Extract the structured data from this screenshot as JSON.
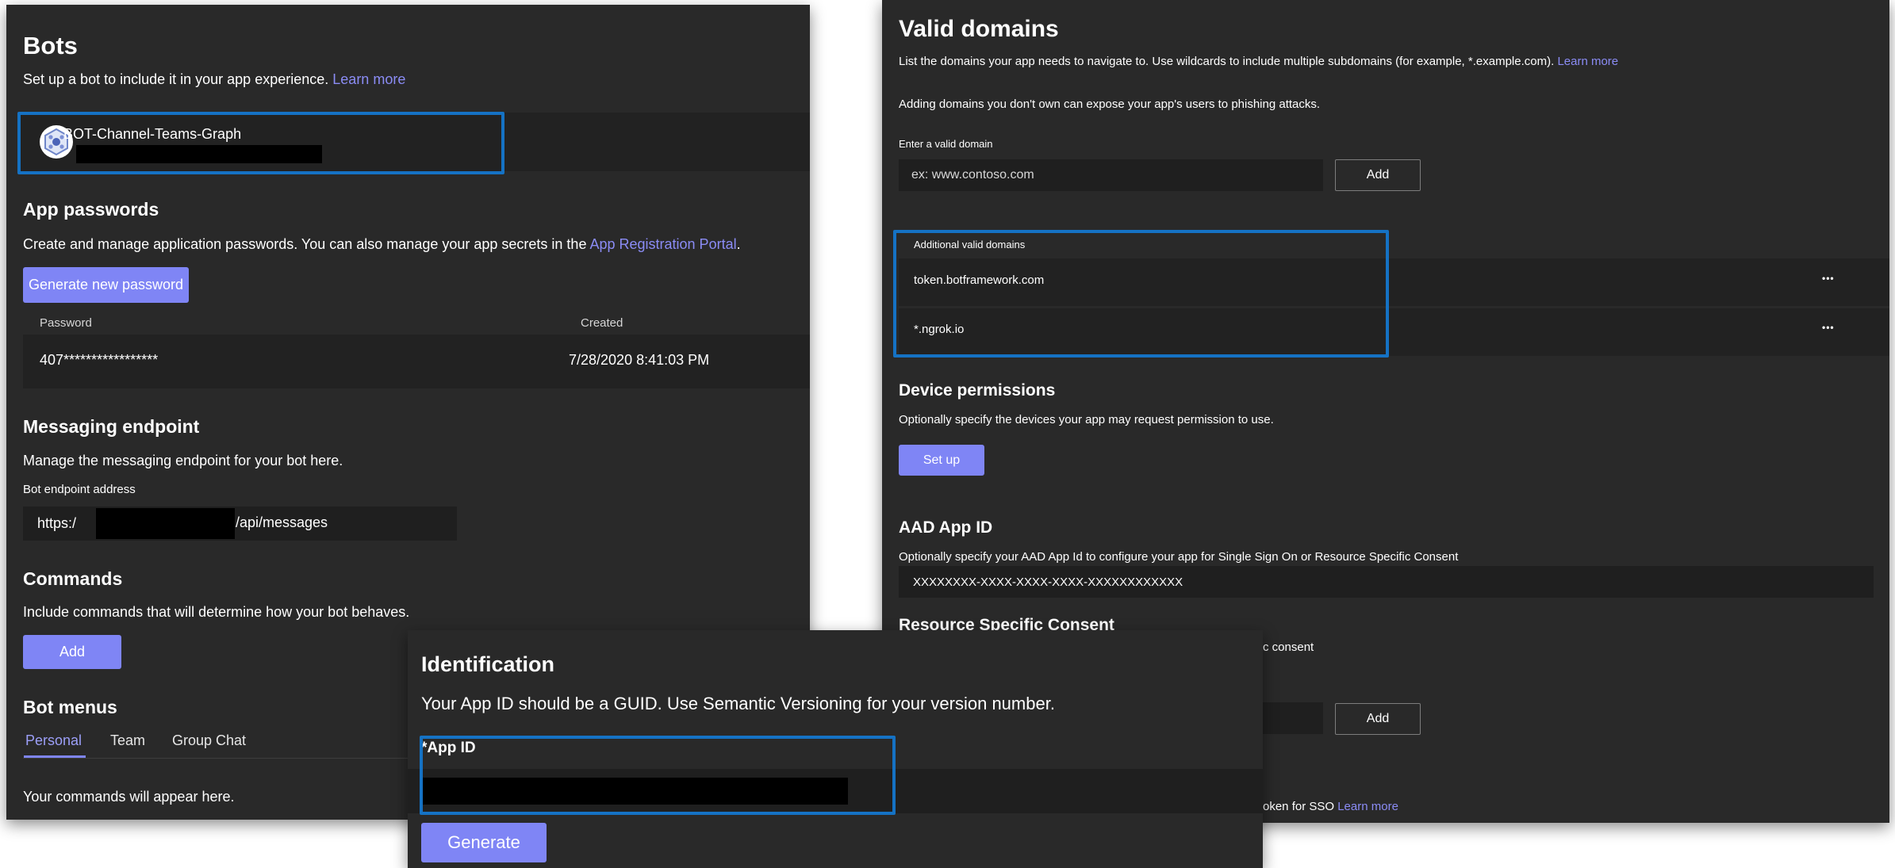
{
  "bots": {
    "title": "Bots",
    "description": "Set up a bot to include it in your app experience.",
    "learn_more": "Learn more",
    "bot_name": "BOT-Channel-Teams-Graph"
  },
  "app_passwords": {
    "title": "App passwords",
    "description": "Create and manage application passwords. You can also manage your app secrets in the",
    "portal_link": "App Registration Portal",
    "period": ".",
    "generate_button": "Generate new password",
    "columns": [
      "Password",
      "Created"
    ],
    "rows": [
      {
        "password": "407*****************",
        "created": "7/28/2020 8:41:03 PM"
      }
    ]
  },
  "messaging_endpoint": {
    "title": "Messaging endpoint",
    "description": "Manage the messaging endpoint for your bot here.",
    "field_label": "Bot endpoint address",
    "prefix": "https:/",
    "suffix": "/api/messages"
  },
  "commands": {
    "title": "Commands",
    "description": "Include commands that will determine how your bot behaves.",
    "add_button": "Add"
  },
  "bot_menus": {
    "title": "Bot menus",
    "tabs": [
      "Personal",
      "Team",
      "Group Chat"
    ],
    "active_tab": "Personal",
    "empty_text": "Your commands will appear here."
  },
  "valid_domains": {
    "title": "Valid domains",
    "description": "List the domains your app needs to navigate to. Use wildcards to include multiple subdomains (for example, *.example.com).",
    "learn_more": "Learn more",
    "warning": "Adding domains you don't own can expose your app's users to phishing attacks.",
    "input_label": "Enter a valid domain",
    "input_placeholder": "ex: www.contoso.com",
    "add_button": "Add",
    "list_header": "Additional valid domains",
    "domains": [
      "token.botframework.com",
      "*.ngrok.io"
    ],
    "more_glyph": "•••"
  },
  "device_permissions": {
    "title": "Device permissions",
    "description": "Optionally specify the devices your app may request permission to use.",
    "setup_button": "Set up"
  },
  "aad_app_id": {
    "title": "AAD App ID",
    "description": "Optionally specify your AAD App Id to configure your app for Single Sign On or Resource Specific Consent",
    "value": "XXXXXXXX-XXXX-XXXX-XXXX-XXXXXXXXXXXX"
  },
  "resource_specific_consent": {
    "title": "Resource Specific Consent",
    "partial_text": "c consent",
    "add_button": "Add"
  },
  "sso": {
    "partial_text": "oken for SSO",
    "learn_more": "Learn more"
  },
  "identification": {
    "title": "Identification",
    "description": "Your App ID should be a GUID. Use Semantic Versioning for your version number.",
    "field_label": "*App ID",
    "generate_button": "Generate"
  },
  "colors": {
    "panel_bg": "#292929",
    "field_bg": "#1f1f1f",
    "accent": "#7f85f5",
    "link": "#8b8cf5",
    "highlight_border": "#1572c4"
  }
}
